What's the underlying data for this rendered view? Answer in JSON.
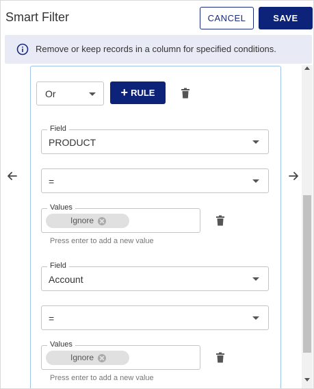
{
  "header": {
    "title": "Smart Filter",
    "cancel_label": "CANCEL",
    "save_label": "SAVE"
  },
  "info": {
    "icon": "info-icon",
    "text": "Remove or keep records in a column for specified conditions."
  },
  "group": {
    "operator": "Or",
    "add_rule_label": "RULE",
    "rules": [
      {
        "field_legend": "Field",
        "field_value": "PRODUCT",
        "comparator": "=",
        "values_legend": "Values",
        "chips": [
          "Ignore"
        ],
        "helper": "Press enter to add a new value"
      },
      {
        "field_legend": "Field",
        "field_value": "Account",
        "comparator": "=",
        "values_legend": "Values",
        "chips": [
          "Ignore"
        ],
        "helper": "Press enter to add a new value"
      }
    ]
  },
  "colors": {
    "primary": "#0d237a",
    "info_bg": "#e8eaf5",
    "group_border": "#9ec3e6",
    "chip_bg": "#e0e0e0"
  }
}
